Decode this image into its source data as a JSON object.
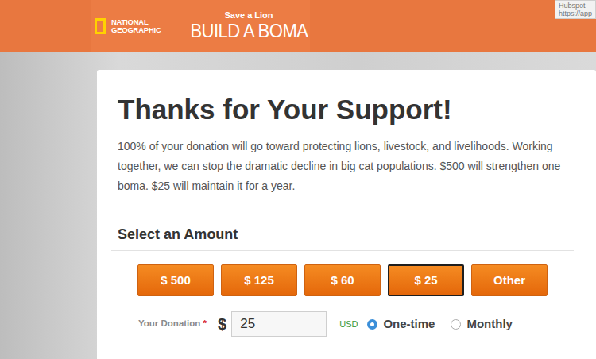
{
  "header": {
    "logo": {
      "line1": "NATIONAL",
      "line2": "GEOGRAPHIC"
    },
    "campaign": {
      "subtitle": "Save a Lion",
      "title": "BUILD A BOMA"
    }
  },
  "tooltip": {
    "lines": [
      "Hubspot",
      "https://app"
    ]
  },
  "card": {
    "title": "Thanks for Your Support!",
    "description": "100% of your donation will go toward protecting lions, livestock, and livelihoods. Working together, we can stop the dramatic decline in big cat populations. $500 will strengthen one boma. $25 will maintain it for a year.",
    "section_title": "Select an Amount"
  },
  "amounts": [
    {
      "label": "$ 500",
      "selected": false
    },
    {
      "label": "$ 125",
      "selected": false
    },
    {
      "label": "$ 60",
      "selected": false
    },
    {
      "label": "$ 25",
      "selected": true
    },
    {
      "label": "Other",
      "selected": false
    }
  ],
  "donation": {
    "label": "Your Donation",
    "required_mark": "*",
    "currency_symbol": "$",
    "value": "25",
    "currency": "USD"
  },
  "frequency": [
    {
      "label": "One-time",
      "selected": true
    },
    {
      "label": "Monthly",
      "selected": false
    }
  ]
}
